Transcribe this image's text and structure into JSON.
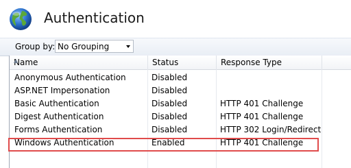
{
  "page": {
    "title": "Authentication",
    "icon": "globe-icon"
  },
  "toolbar": {
    "group_by_label": "Group by:",
    "group_by_value": "No Grouping"
  },
  "columns": [
    "Name",
    "Status",
    "Response Type"
  ],
  "rows": [
    {
      "name": "Anonymous Authentication",
      "status": "Disabled",
      "response": ""
    },
    {
      "name": "ASP.NET Impersonation",
      "status": "Disabled",
      "response": ""
    },
    {
      "name": "Basic Authentication",
      "status": "Disabled",
      "response": "HTTP 401 Challenge"
    },
    {
      "name": "Digest Authentication",
      "status": "Disabled",
      "response": "HTTP 401 Challenge"
    },
    {
      "name": "Forms Authentication",
      "status": "Disabled",
      "response": "HTTP 302 Login/Redirect"
    },
    {
      "name": "Windows Authentication",
      "status": "Enabled",
      "response": "HTTP 401 Challenge"
    }
  ],
  "colors": {
    "highlight": "#e04b4b",
    "globe_blue": "#2a6fc9",
    "globe_green": "#5aa83a"
  }
}
